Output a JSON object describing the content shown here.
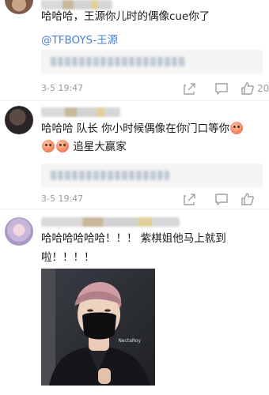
{
  "comments": [
    {
      "text": "哈哈哈，王源你儿时的偶像cue你了",
      "mention": "@TFBOYS-王源",
      "time": "3-5 19:47",
      "like_count": "20",
      "avatar_icon": "user-avatar",
      "username_icon": "blurred-username"
    },
    {
      "line1": "哈哈哈 队长 你小时候偶像在你门口等你",
      "line2": "追星大赢家",
      "time": "3-5 19:47",
      "avatar_icon": "user-avatar",
      "username_icon": "blurred-username"
    },
    {
      "line1": "哈哈哈哈哈哈！！！   紫棋姐他马上就到",
      "line2": "啦！！！！",
      "photo_watermark": "NectaRoy",
      "avatar_icon": "user-avatar",
      "username_icon": "blurred-username"
    }
  ],
  "icons": {
    "share": "share-icon",
    "reply": "comment-icon",
    "like": "thumbs-up-icon"
  },
  "colors": {
    "mention": "#4a7fd0",
    "meta": "#9a9a9a",
    "emoji": "#f07b55"
  }
}
